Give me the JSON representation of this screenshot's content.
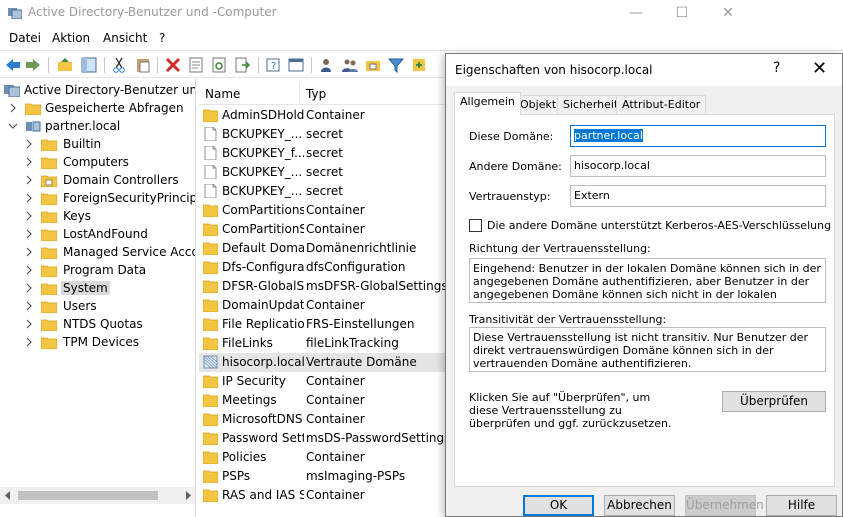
{
  "window": {
    "title": "Active Directory-Benutzer und -Computer",
    "minimize": "—",
    "maximize": "☐",
    "close": "✕"
  },
  "menu": [
    "Datei",
    "Aktion",
    "Ansicht",
    "?"
  ],
  "tree": {
    "root": "Active Directory-Benutzer und -Computer",
    "saved_queries": "Gespeicherte Abfragen",
    "domain": "partner.local",
    "children": [
      "Builtin",
      "Computers",
      "Domain Controllers",
      "ForeignSecurityPrincipals",
      "Keys",
      "LostAndFound",
      "Managed Service Accounts",
      "Program Data",
      "System",
      "Users",
      "NTDS Quotas",
      "TPM Devices"
    ],
    "selected": "System"
  },
  "list": {
    "columns": [
      "Name",
      "Typ"
    ],
    "rows": [
      {
        "name": "AdminSDHolder",
        "type": "Container",
        "icon": "folder"
      },
      {
        "name": "BCKUPKEY_...",
        "type": "secret",
        "icon": "page"
      },
      {
        "name": "BCKUPKEY_f...",
        "type": "secret",
        "icon": "page"
      },
      {
        "name": "BCKUPKEY_...",
        "type": "secret",
        "icon": "page"
      },
      {
        "name": "BCKUPKEY_...",
        "type": "secret",
        "icon": "page"
      },
      {
        "name": "ComPartitions",
        "type": "Container",
        "icon": "folder"
      },
      {
        "name": "ComPartitionSets",
        "type": "Container",
        "icon": "folder"
      },
      {
        "name": "Default Domain Policy",
        "type": "Domänenrichtlinie",
        "icon": "folder"
      },
      {
        "name": "Dfs-Configuration",
        "type": "dfsConfiguration",
        "icon": "folder"
      },
      {
        "name": "DFSR-GlobalSettings",
        "type": "msDFSR-GlobalSettings",
        "icon": "folder"
      },
      {
        "name": "DomainUpdates",
        "type": "Container",
        "icon": "folder"
      },
      {
        "name": "File Replication Service",
        "type": "FRS-Einstellungen",
        "icon": "folder"
      },
      {
        "name": "FileLinks",
        "type": "fileLinkTracking",
        "icon": "folder"
      },
      {
        "name": "hisocorp.local",
        "type": "Vertraute Domäne",
        "icon": "trust"
      },
      {
        "name": "IP Security",
        "type": "Container",
        "icon": "folder"
      },
      {
        "name": "Meetings",
        "type": "Container",
        "icon": "folder"
      },
      {
        "name": "MicrosoftDNS",
        "type": "Container",
        "icon": "folder"
      },
      {
        "name": "Password Settings Container",
        "type": "msDS-PasswordSettingsContainer",
        "icon": "folder"
      },
      {
        "name": "Policies",
        "type": "Container",
        "icon": "folder"
      },
      {
        "name": "PSPs",
        "type": "msImaging-PSPs",
        "icon": "folder"
      },
      {
        "name": "RAS and IAS Servers Access Check",
        "type": "Container",
        "icon": "folder"
      }
    ],
    "selected_index": 13
  },
  "dialog": {
    "title": "Eigenschaften von hisocorp.local",
    "help": "?",
    "close": "✕",
    "tabs": [
      "Allgemein",
      "Objekt",
      "Sicherheit",
      "Attribut-Editor"
    ],
    "active_tab": "Allgemein",
    "this_domain_label": "Diese Domäne:",
    "this_domain_value": "partner.local",
    "other_domain_label": "Andere Domäne:",
    "other_domain_value": "hisocorp.local",
    "trust_type_label": "Vertrauenstyp:",
    "trust_type_value": "Extern",
    "kerberos_checkbox_label": "Die andere Domäne unterstützt Kerberos-AES-Verschlüsselung",
    "kerberos_checked": false,
    "direction_label": "Richtung der Vertrauensstellung:",
    "direction_text": "Eingehend: Benutzer in der lokalen Domäne können sich in der angegebenen Domäne authentifizieren, aber Benutzer in der angegebenen Domäne können sich nicht in der lokalen Domäne",
    "transitivity_label": "Transitivität der Vertrauensstellung:",
    "transitivity_text": "Diese Vertrauensstellung ist nicht transitiv. Nur Benutzer der direkt vertrauenswürdigen Domäne können sich in der vertrauenden Domäne authentifizieren.",
    "verify_text": "Klicken Sie auf \"Überprüfen\", um diese Vertrauensstellung zu überprüfen und ggf. zurückzusetzen.",
    "verify_button": "Überprüfen",
    "ok_button": "OK",
    "cancel_button": "Abbrechen",
    "apply_button": "Übernehmen",
    "help_button": "Hilfe"
  },
  "colors": {
    "selection_blue": "#0078d7",
    "folder_yellow": "#f4c542",
    "dialog_bg": "#f0f0f0"
  }
}
